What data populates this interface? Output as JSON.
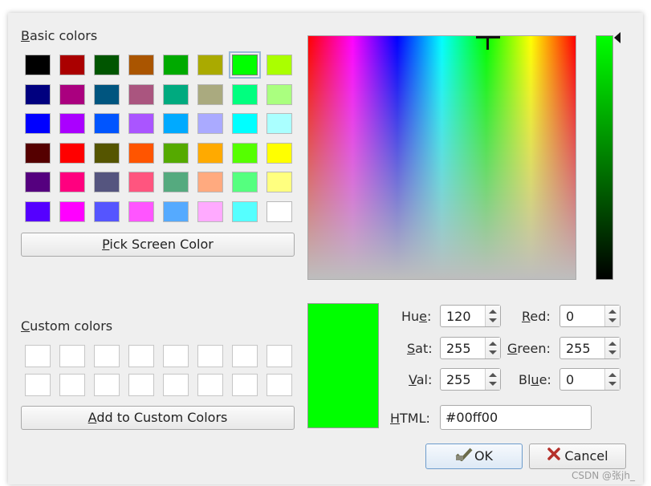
{
  "labels": {
    "basic_pre": "",
    "basic_u": "B",
    "basic_post": "asic colors",
    "custom_pre": "",
    "custom_u": "C",
    "custom_post": "ustom colors",
    "hue_pre": "Hu",
    "hue_u": "e",
    "hue_post": ":",
    "sat_pre": "",
    "sat_u": "S",
    "sat_post": "at:",
    "val_pre": "",
    "val_u": "V",
    "val_post": "al:",
    "red_pre": "",
    "red_u": "R",
    "red_post": "ed:",
    "green_pre": "",
    "green_u": "G",
    "green_post": "reen:",
    "blue_pre": "Bl",
    "blue_u": "u",
    "blue_post": "e:",
    "html_pre": "",
    "html_u": "H",
    "html_post": "TML:"
  },
  "buttons": {
    "pick_pre": "",
    "pick_u": "P",
    "pick_post": "ick Screen Color",
    "add_pre": "",
    "add_u": "A",
    "add_post": "dd to Custom Colors",
    "ok": "OK",
    "cancel": "Cancel"
  },
  "values": {
    "hue": "120",
    "sat": "255",
    "val": "255",
    "red": "0",
    "green": "255",
    "blue": "0",
    "html": "#00ff00"
  },
  "current_color": "#00ff00",
  "basic_colors": [
    [
      "#000000",
      "#aa0000",
      "#005500",
      "#aa5500",
      "#00aa00",
      "#aaaa00",
      "#00ff00",
      "#aaff00"
    ],
    [
      "#00007f",
      "#aa007f",
      "#00557f",
      "#aa557f",
      "#00aa7f",
      "#aaaa7f",
      "#00ff7f",
      "#aaff7f"
    ],
    [
      "#0000ff",
      "#aa00ff",
      "#0055ff",
      "#aa55ff",
      "#00aaff",
      "#aaaaff",
      "#00ffff",
      "#aaffff"
    ],
    [
      "#550000",
      "#ff0000",
      "#555500",
      "#ff5500",
      "#55aa00",
      "#ffaa00",
      "#55ff00",
      "#ffff00"
    ],
    [
      "#55007f",
      "#ff007f",
      "#55557f",
      "#ff557f",
      "#55aa7f",
      "#ffaa7f",
      "#55ff7f",
      "#ffff7f"
    ],
    [
      "#5500ff",
      "#ff00ff",
      "#5555ff",
      "#ff55ff",
      "#55aaff",
      "#ffaaff",
      "#55ffff",
      "#ffffff"
    ]
  ],
  "selected_swatch": {
    "row": 0,
    "col": 6
  },
  "watermark": "CSDN @张jh_"
}
